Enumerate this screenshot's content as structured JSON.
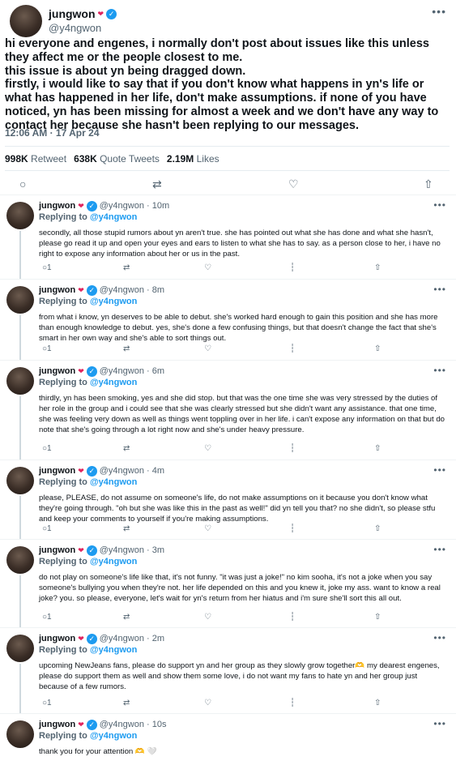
{
  "main": {
    "display_name": "jungwon",
    "heart": "❤",
    "handle": "@y4ngwon",
    "more": "•••",
    "paragraphs": [
      "hi everyone and engenes, i normally don't post about issues like this unless they affect me or the people closest to me.",
      "this issue is about yn being dragged down.",
      "firstly, i would like to say that if you don't know what happens in yn's life or what has happened in her life, don't make assumptions. if none of you have noticed, yn has been missing for almost a week and we don't have any way to contact her because she hasn't been replying to our messages."
    ],
    "timestamp": "12:06 AM · 17 Apr 24",
    "stats": {
      "retweets_value": "998K",
      "retweets_label": "Retweet",
      "quotes_value": "638K",
      "quotes_label": "Quote Tweets",
      "likes_value": "2.19M",
      "likes_label": "Likes"
    },
    "actions": {
      "reply_icon": "○",
      "retweet_icon": "⇄",
      "like_icon": "♡",
      "share_icon": "⇧"
    }
  },
  "replies": [
    {
      "display_name": "jungwon",
      "handle_time": "@y4ngwon · 10m",
      "replying_label": "Replying to",
      "replying_handle": "@y4ngwon",
      "text": "secondly, all those stupid rumors about yn aren't true. she has pointed out what she has done and what she hasn't, please go read it up and open your eyes and ears to listen to what she has to say. as a person close to her, i have no right to expose any information about her or us in the past.",
      "reply_count": "1"
    },
    {
      "display_name": "jungwon",
      "handle_time": "@y4ngwon · 8m",
      "replying_label": "Replying to",
      "replying_handle": "@y4ngwon",
      "text": "from what i know, yn deserves to be able to debut. she's worked hard enough to gain this position and she has more than enough knowledge to debut. yes, she's done a few confusing things, but that doesn't change the fact that she's smart in her own way and she's able to sort things out.",
      "reply_count": "1"
    },
    {
      "display_name": "jungwon",
      "handle_time": "@y4ngwon · 6m",
      "replying_label": "Replying to",
      "replying_handle": "@y4ngwon",
      "text": "thirdly, yn has been smoking, yes and she did stop. but that was the one time she was very stressed by the duties of her role in the group and i could see that she was clearly stressed but she didn't want any assistance. that one time, she was feeling very down as well as things went toppling over in her life. i can't expose any information on that but do note that she's going through a lot right now and she's under heavy pressure.",
      "reply_count": "1"
    },
    {
      "display_name": "jungwon",
      "handle_time": "@y4ngwon · 4m",
      "replying_label": "Replying to",
      "replying_handle": "@y4ngwon",
      "text": "please, PLEASE, do not assume on someone's life, do not make assumptions on it because you don't know what they're going through. \"oh but she was like this in the past as well!\" did yn tell you that? no she didn't, so please stfu and keep your comments to yourself if you're making assumptions.",
      "reply_count": "1"
    },
    {
      "display_name": "jungwon",
      "handle_time": "@y4ngwon · 3m",
      "replying_label": "Replying to",
      "replying_handle": "@y4ngwon",
      "text": "do not play on someone's life like that, it's not funny. \"it was just a joke!\" no kim sooha, it's not a joke when you say someone's bullying you when they're not. her life depended on this and you knew it, joke my ass. want to know a real joke? you. so please, everyone, let's wait for yn's return from her hiatus and i'm sure she'll sort this all out.",
      "reply_count": "1"
    },
    {
      "display_name": "jungwon",
      "handle_time": "@y4ngwon · 2m",
      "replying_label": "Replying to",
      "replying_handle": "@y4ngwon",
      "text": "upcoming NewJeans fans, please do support yn and her group as they slowly grow together🫶 my dearest engenes, please do support them as well and show them some love, i do not want my fans to hate yn and her group just because of a few rumors.",
      "reply_count": "1"
    },
    {
      "display_name": "jungwon",
      "handle_time": "@y4ngwon · 10s",
      "replying_label": "Replying to",
      "replying_handle": "@y4ngwon",
      "text": "thank you for your attention 🫶 🤍",
      "reply_count": ""
    }
  ],
  "reply_actions": {
    "reply_icon": "○",
    "retweet_icon": "⇄",
    "like_icon": "♡",
    "views_icon": "┆",
    "share_icon": "⇧"
  }
}
